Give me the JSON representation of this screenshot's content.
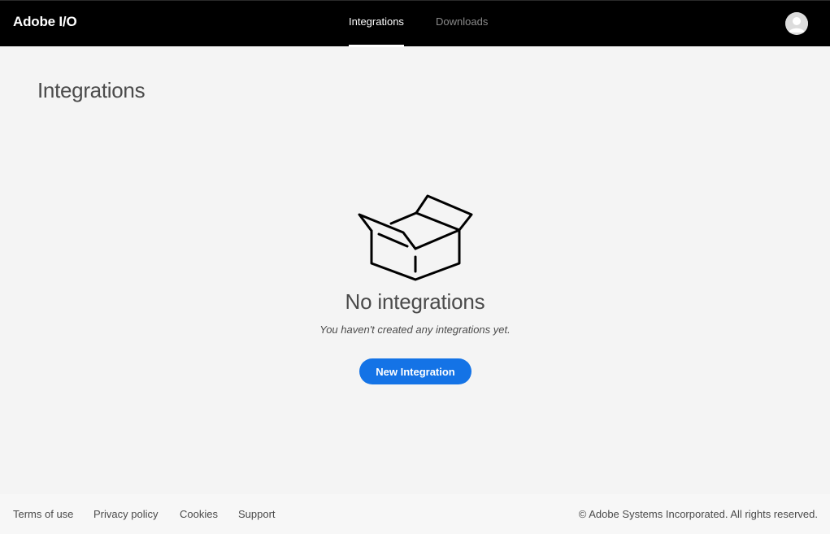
{
  "header": {
    "brand": "Adobe I/O",
    "tabs": [
      {
        "label": "Integrations",
        "active": true
      },
      {
        "label": "Downloads",
        "active": false
      }
    ],
    "avatar_icon": "user-avatar-icon"
  },
  "main": {
    "title": "Integrations",
    "empty_state": {
      "icon": "open-box-icon",
      "title": "No integrations",
      "subtitle": "You haven't created any integrations yet.",
      "button_label": "New Integration"
    }
  },
  "footer": {
    "links": [
      "Terms of use",
      "Privacy policy",
      "Cookies",
      "Support"
    ],
    "copyright": "© Adobe Systems Incorporated. All rights reserved."
  },
  "colors": {
    "header_bg": "#000000",
    "page_bg": "#f4f4f4",
    "accent": "#1473e6",
    "text": "#4b4b4b"
  }
}
